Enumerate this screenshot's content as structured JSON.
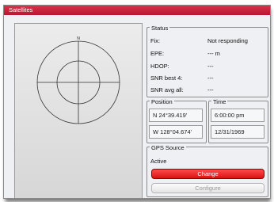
{
  "window": {
    "title": "Satellites"
  },
  "status": {
    "title": "Status",
    "rows": [
      {
        "label": "Fix:",
        "value": "Not responding"
      },
      {
        "label": "EPE:",
        "value": "--- m"
      },
      {
        "label": "HDOP:",
        "value": "---"
      },
      {
        "label": "SNR best 4:",
        "value": "---"
      },
      {
        "label": "SNR avg all:",
        "value": "---"
      }
    ]
  },
  "position": {
    "title": "Position",
    "lat": "N 24°39.419'",
    "lon": "W 128°04.674'"
  },
  "time": {
    "title": "Time",
    "time": "6:00:00 pm",
    "date": "12/31/1969"
  },
  "gps_source": {
    "title": "GPS Source",
    "active_label": "Active",
    "change_label": "Change",
    "configure_label": "Configure"
  },
  "sky_view": {
    "north_label": "N"
  },
  "colors": {
    "title_bar": "#c41e3a",
    "change_button": "#e42020"
  }
}
